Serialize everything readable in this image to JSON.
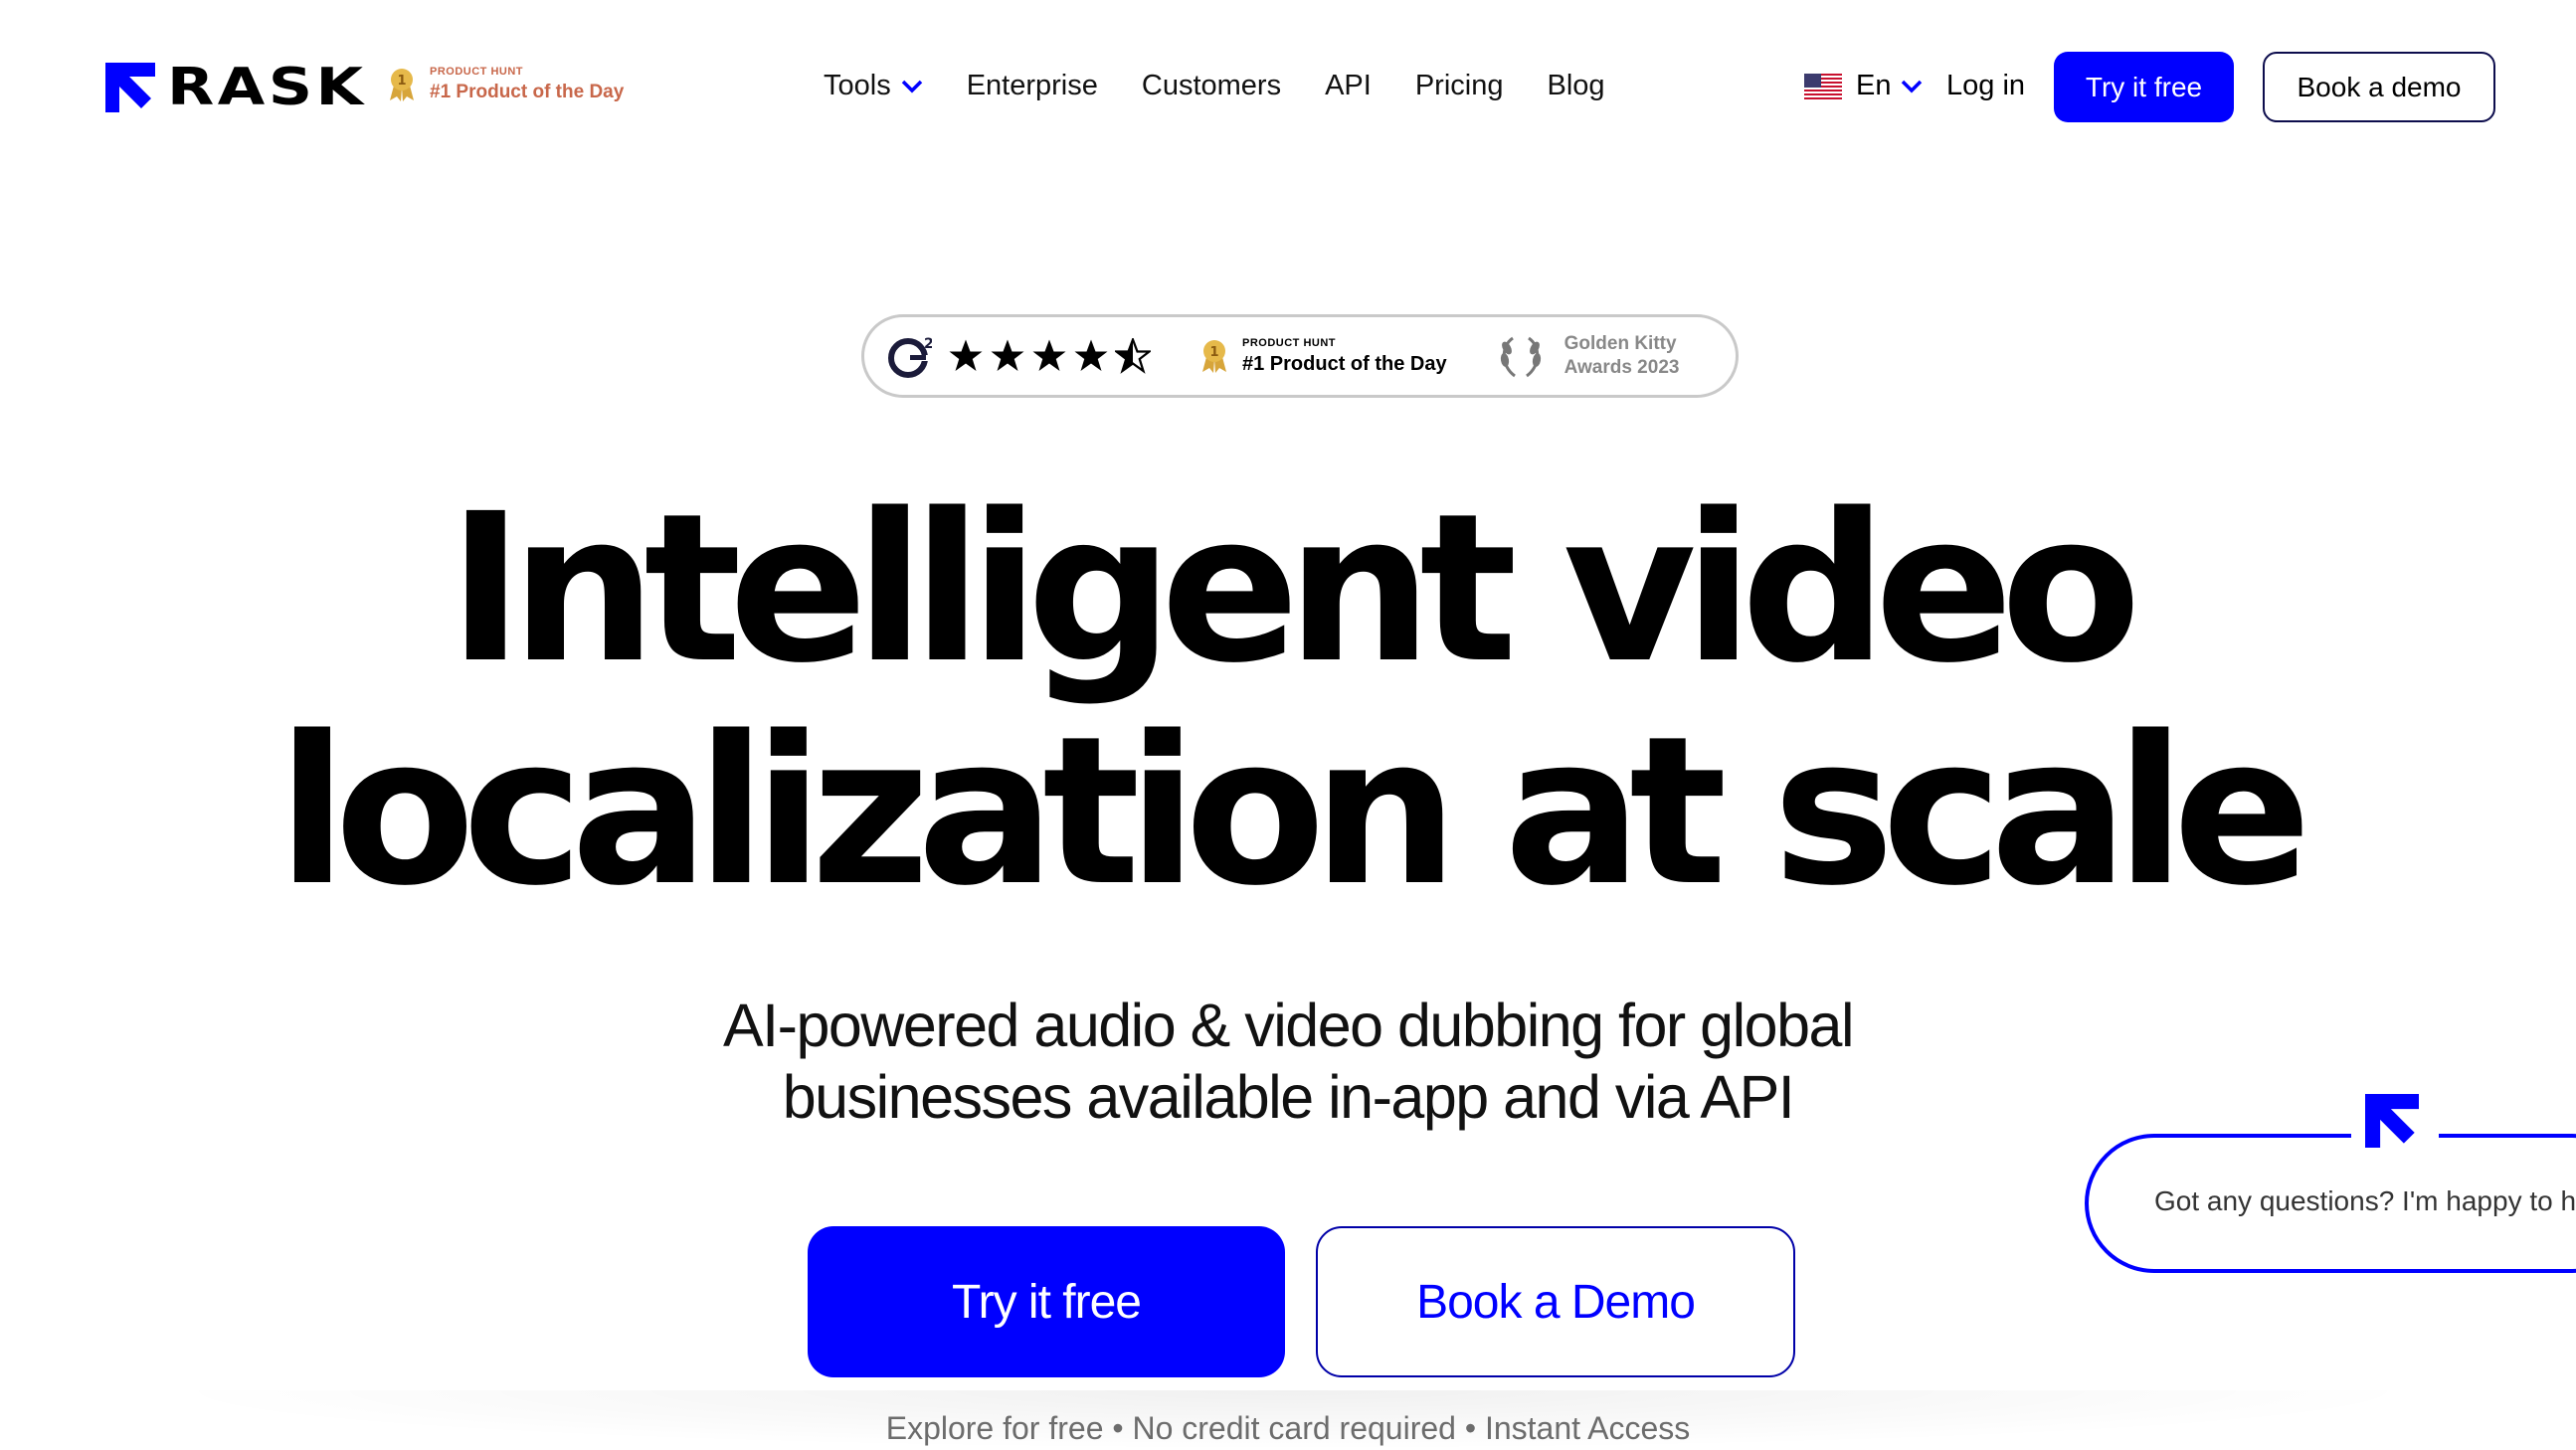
{
  "header": {
    "logo_text": "RASK",
    "product_hunt": {
      "kicker": "PRODUCT HUNT",
      "title": "#1 Product of the Day"
    },
    "nav": [
      {
        "label": "Tools",
        "has_dropdown": true
      },
      {
        "label": "Enterprise"
      },
      {
        "label": "Customers"
      },
      {
        "label": "API"
      },
      {
        "label": "Pricing"
      },
      {
        "label": "Blog"
      }
    ],
    "language": {
      "label": "En",
      "flag_icon": "us-flag-icon"
    },
    "login_label": "Log in",
    "try_label": "Try it free",
    "demo_label": "Book a demo"
  },
  "awards": {
    "g2_rating": 4.5,
    "product_hunt": {
      "kicker": "PRODUCT HUNT",
      "title": "#1 Product of the Day"
    },
    "golden_kitty": {
      "line1": "Golden Kitty",
      "line2": "Awards 2023"
    }
  },
  "hero": {
    "title_line1": "Intelligent video",
    "title_line2": "localization at scale",
    "subtitle_line1": "AI-powered audio & video dubbing for global",
    "subtitle_line2": "businesses available in-app and via API",
    "cta_primary": "Try it free",
    "cta_secondary": "Book a Demo",
    "footnote": "Explore for free • No credit card required • Instant Access"
  },
  "chat": {
    "message": "Got any questions? I'm happy to help."
  },
  "colors": {
    "brand_blue": "#0000ff",
    "text": "#000000",
    "award_orange": "#c8674a"
  }
}
